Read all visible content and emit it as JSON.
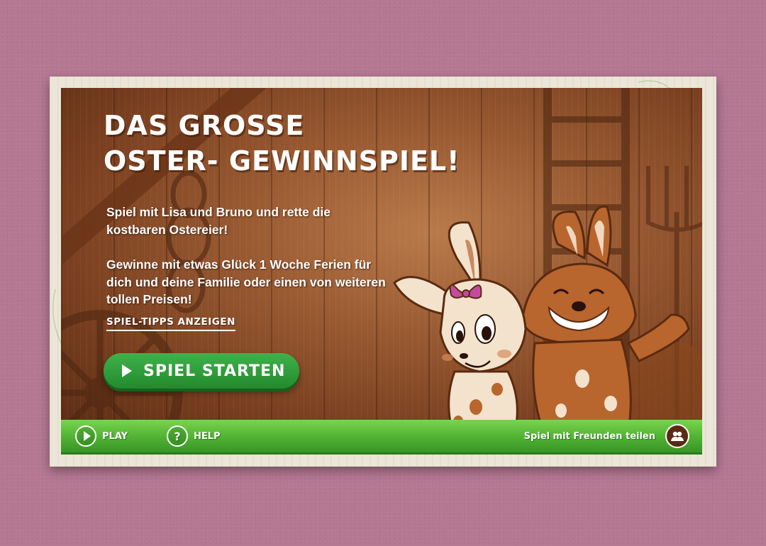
{
  "title": {
    "line1": "DAS GROSSE",
    "line2": "OSTER- GEWINNSPIEL!"
  },
  "intro": {
    "paragraph1": "Spiel mit Lisa und Bruno und rette die kostbaren Ostereier!",
    "paragraph2": "Gewinne mit etwas Glück 1 Woche Ferien für dich und deine Familie oder einen von weiteren tollen Preisen!"
  },
  "tips_link": "SPIEL-TIPPS ANZEIGEN",
  "start_button": "SPIEL STARTEN",
  "bottom_bar": {
    "play_label": "PLAY",
    "help_label": "HELP",
    "help_icon_glyph": "?",
    "share_label": "Spiel mit Freunden teilen"
  },
  "colors": {
    "page_background": "#b57892",
    "wood": "#9a5b33",
    "green_bar": "#4fb232",
    "start_button": "#2e9c3a",
    "bow": "#c44aa0"
  },
  "icons": [
    "play-icon",
    "help-icon",
    "friends-icon"
  ]
}
